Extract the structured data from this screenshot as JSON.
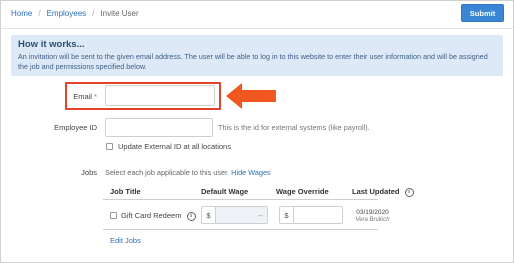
{
  "breadcrumb": {
    "home": "Home",
    "employees": "Employees",
    "current": "Invite User",
    "separator": "/"
  },
  "toolbar": {
    "submit_label": "Submit"
  },
  "info": {
    "title": "How it works...",
    "text": "An invitation will be sent to the given email address. The user will be able to log in to this website to enter their user information and will be assigned the job and permissions specified below."
  },
  "form": {
    "email_label": "Email",
    "email_required": "*",
    "email_value": "",
    "employee_id_label": "Employee ID",
    "employee_id_value": "",
    "employee_id_hint": "This is the id for external systems (like payroll).",
    "update_external_label": "Update External ID at all locations",
    "jobs_label": "Jobs",
    "jobs_hint": "Select each job applicable to this user.",
    "hide_wages_link": "Hide Wages"
  },
  "jobs_table": {
    "headers": [
      "Job Title",
      "Default Wage",
      "Wage Override",
      "Last Updated"
    ],
    "rows": [
      {
        "title": "Gift Card Redeem",
        "currency": "$",
        "default_wage": "--",
        "override": "",
        "last_updated_date": "03/19/2020",
        "last_updated_by": "Vera Brukich"
      }
    ],
    "edit_jobs_link": "Edit Jobs"
  },
  "colors": {
    "accent": "#3a86d4",
    "highlight": "#e0432a",
    "arrow": "#f0581f",
    "info_bg": "#dde9f7"
  }
}
